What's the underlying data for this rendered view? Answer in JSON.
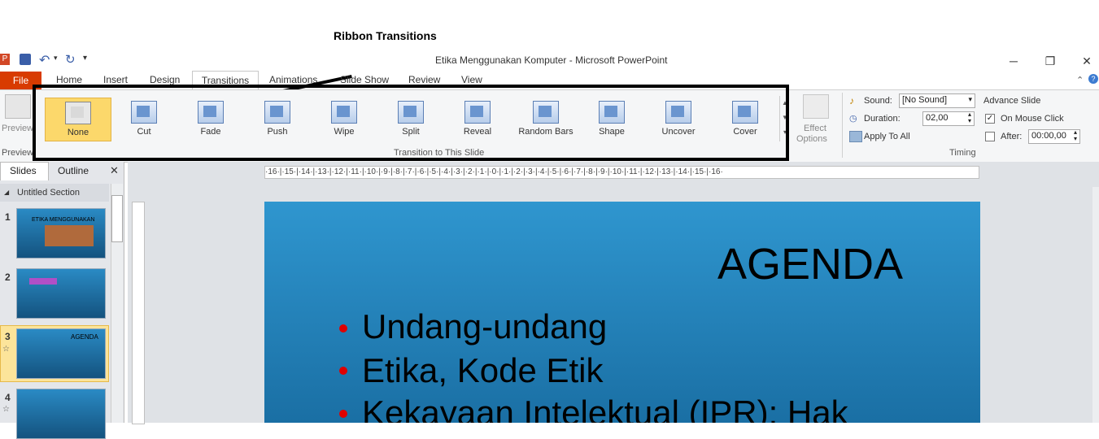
{
  "annotation": {
    "label": "Ribbon Transitions"
  },
  "window": {
    "title": "Etika Menggunakan Komputer  -  Microsoft PowerPoint",
    "minimize": "─",
    "restore": "❐",
    "close": "✕"
  },
  "tabs": [
    "File",
    "Home",
    "Insert",
    "Design",
    "Transitions",
    "Animations",
    "Slide Show",
    "Review",
    "View"
  ],
  "ribbon": {
    "preview_label": "Preview",
    "preview_group": "Preview",
    "transitions": [
      "None",
      "Cut",
      "Fade",
      "Push",
      "Wipe",
      "Split",
      "Reveal",
      "Random Bars",
      "Shape",
      "Uncover",
      "Cover"
    ],
    "transition_group": "Transition to This Slide",
    "effect_options_1": "Effect",
    "effect_options_2": "Options",
    "sound_label": "Sound:",
    "sound_value": "[No Sound]",
    "duration_label": "Duration:",
    "duration_value": "02,00",
    "apply_all": "Apply To All",
    "advance_label": "Advance Slide",
    "on_mouse_click": "On Mouse Click",
    "after_label": "After:",
    "after_value": "00:00,00",
    "timing_group": "Timing"
  },
  "left_pane": {
    "tab_slides": "Slides",
    "tab_outline": "Outline",
    "section": "Untitled Section",
    "slides": [
      {
        "num": "1",
        "title": "ETIKA MENGGUNAKAN"
      },
      {
        "num": "2",
        "title": ""
      },
      {
        "num": "3",
        "title": "AGENDA"
      },
      {
        "num": "4",
        "title": ""
      }
    ]
  },
  "ruler": {
    "h": "·16·|·15·|·14·|·13·|·12·|·11·|·10·|·9·|·8·|·7·|·6·|·5·|·4·|·3·|·2·|·1·|·0·|·1·|·2·|·3·|·4·|·5·|·6·|·7·|·8·|·9·|·10·|·11·|·12·|·13·|·14·|·15·|·16·"
  },
  "slide": {
    "title": "AGENDA",
    "bullets": [
      "Undang-undang",
      "Etika, Kode Etik",
      "Kekayaan Intelektual (IPR): Hak"
    ]
  },
  "colors": {
    "file_tab": "#d83b01",
    "selected_item": "#fcd86b",
    "bullet": "#e00000"
  }
}
